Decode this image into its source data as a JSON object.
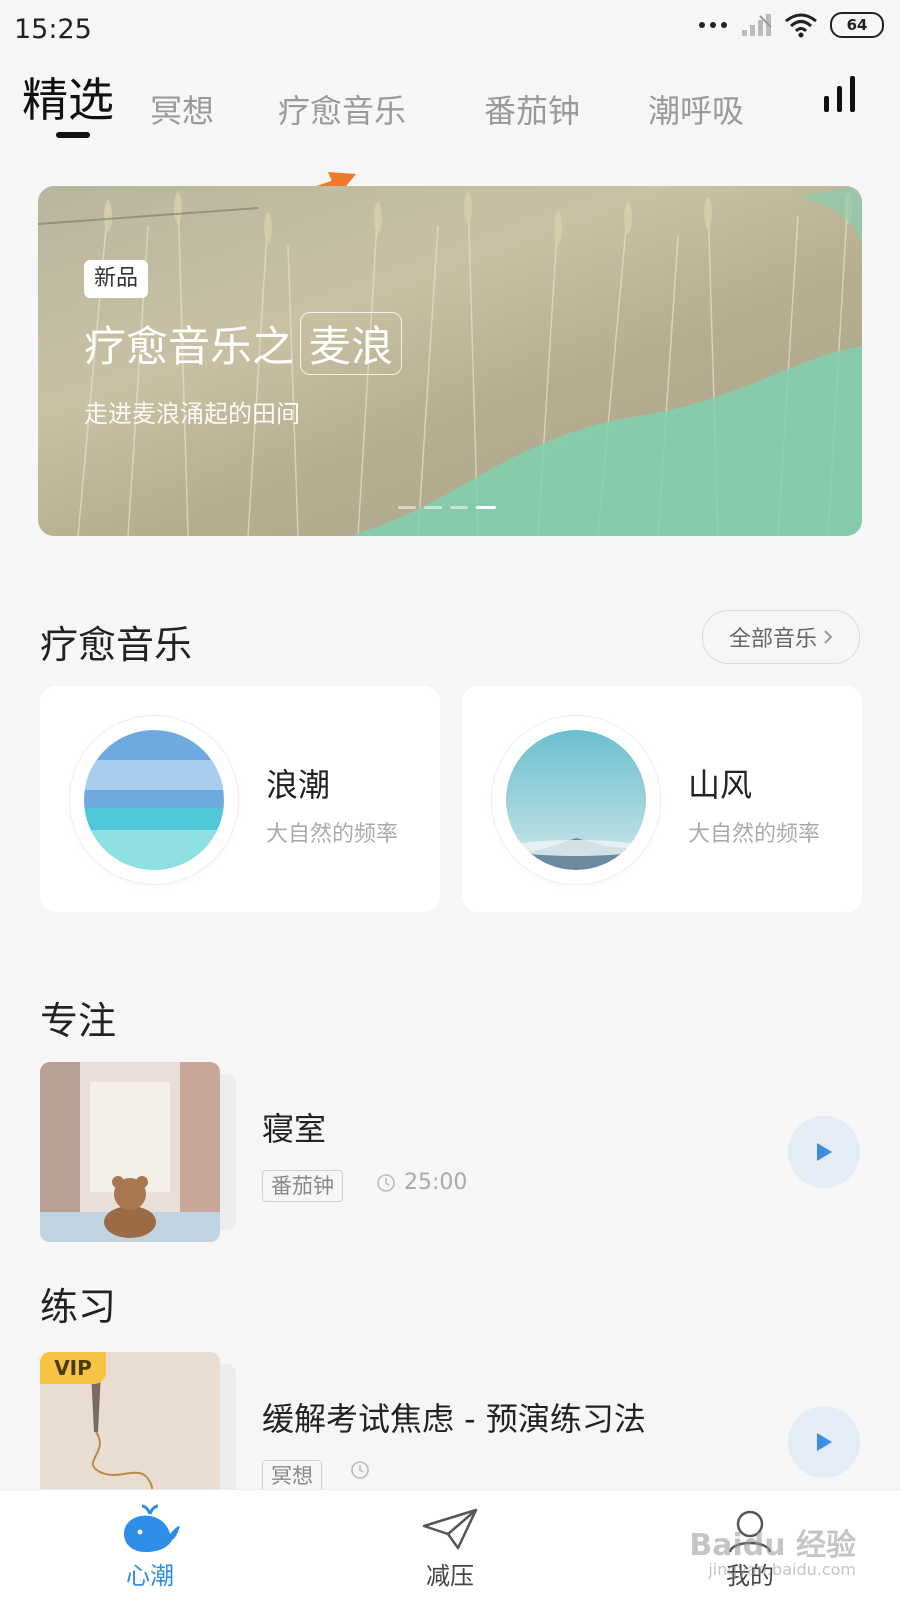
{
  "status_bar": {
    "time": "15:25",
    "battery": "64"
  },
  "tabs": [
    {
      "label": "精选",
      "active": true
    },
    {
      "label": "冥想"
    },
    {
      "label": "疗愈音乐"
    },
    {
      "label": "番茄钟"
    },
    {
      "label": "潮呼吸"
    }
  ],
  "banner": {
    "badge": "新品",
    "title_prefix": "疗愈音乐之",
    "title_highlight": "麦浪",
    "subtitle": "走进麦浪涌起的田间",
    "page_count": 4,
    "active_page": 4
  },
  "music_section": {
    "title": "疗愈音乐",
    "all_label": "全部音乐",
    "items": [
      {
        "name": "浪潮",
        "desc": "大自然的频率"
      },
      {
        "name": "山风",
        "desc": "大自然的频率"
      }
    ]
  },
  "focus_section": {
    "title": "专注",
    "item": {
      "title": "寝室",
      "tag": "番茄钟",
      "duration": "25:00"
    }
  },
  "practice_section": {
    "title": "练习",
    "item": {
      "title": "缓解考试焦虑 - 预演练习法",
      "tag": "冥想",
      "vip": "VIP"
    }
  },
  "bottom_nav": [
    {
      "label": "心潮",
      "active": true
    },
    {
      "label": "减压"
    },
    {
      "label": "我的"
    }
  ],
  "watermark": {
    "main": "Baidu 经验",
    "sub": "jingyan.baidu.com"
  },
  "colors": {
    "accent": "#2e8de6",
    "banner_wave": "#7fd0b0",
    "vip": "#f6c343",
    "play_bg": "#e4edf7",
    "arrow": "#f07a2a"
  }
}
